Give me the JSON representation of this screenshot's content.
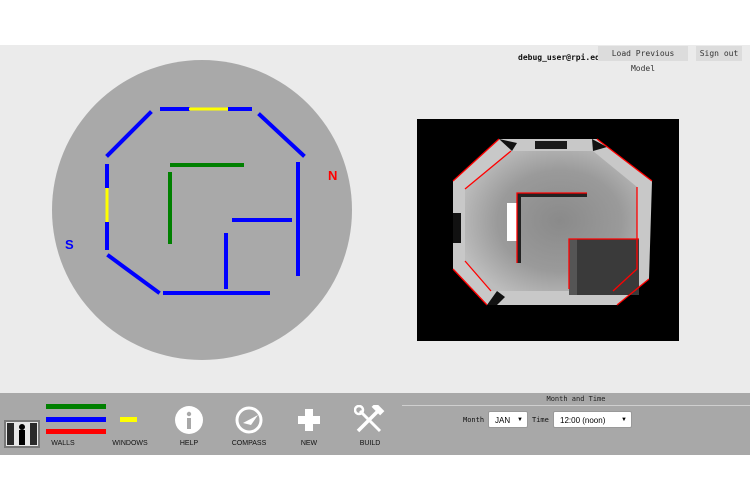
{
  "header": {
    "user_email": "debug_user@rpi.edu",
    "load_button": "Load Previous Model",
    "signout_button": "Sign out"
  },
  "floorplan": {
    "north_label": "N",
    "south_label": "S",
    "colors": {
      "circle": "#a9a9a9",
      "wall": "#0000ff",
      "window": "#ffff00",
      "interior": "#008000",
      "north": "#ff0000",
      "south": "#0000ff"
    }
  },
  "toolbar": {
    "walls_label": "WALLS",
    "windows_label": "WINDOWS",
    "help_label": "HELP",
    "compass_label": "COMPASS",
    "new_label": "NEW",
    "build_label": "BUILD",
    "swatch_colors": [
      "#008000",
      "#0000ff",
      "#ff0000",
      "#ffff00"
    ]
  },
  "month_time": {
    "title": "Month and Time",
    "month_label": "Month",
    "month_value": "JAN",
    "time_label": "Time",
    "time_value": "12:00 (noon)"
  }
}
